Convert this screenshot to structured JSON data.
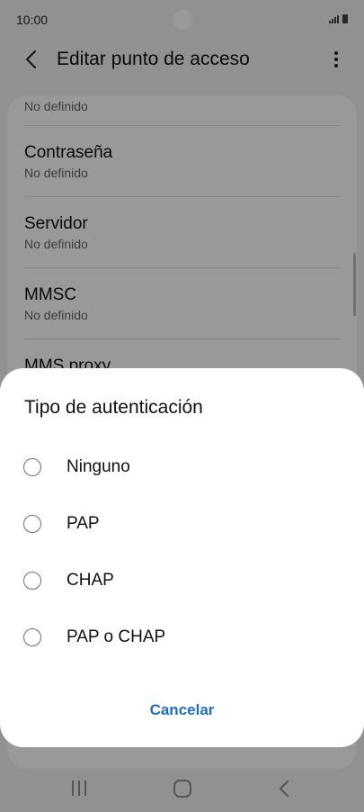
{
  "status_bar": {
    "time": "10:00"
  },
  "app_bar": {
    "title": "Editar punto de acceso",
    "back_icon": "chevron-left-icon",
    "more_icon": "more-vert-icon"
  },
  "settings_list": [
    {
      "title": "",
      "value": "No definido"
    },
    {
      "title": "Contraseña",
      "value": "No definido"
    },
    {
      "title": "Servidor",
      "value": "No definido"
    },
    {
      "title": "MMSC",
      "value": "No definido"
    },
    {
      "title": "MMS proxy",
      "value": ""
    }
  ],
  "dialog": {
    "title": "Tipo de autenticación",
    "options": [
      {
        "label": "Ninguno",
        "selected": false
      },
      {
        "label": "PAP",
        "selected": false
      },
      {
        "label": "CHAP",
        "selected": false
      },
      {
        "label": "PAP o CHAP",
        "selected": false
      }
    ],
    "cancel_label": "Cancelar",
    "accent_color": "#1c6fc4"
  },
  "nav_bar": {
    "icons": [
      "recent-apps-icon",
      "home-icon",
      "back-icon"
    ]
  }
}
